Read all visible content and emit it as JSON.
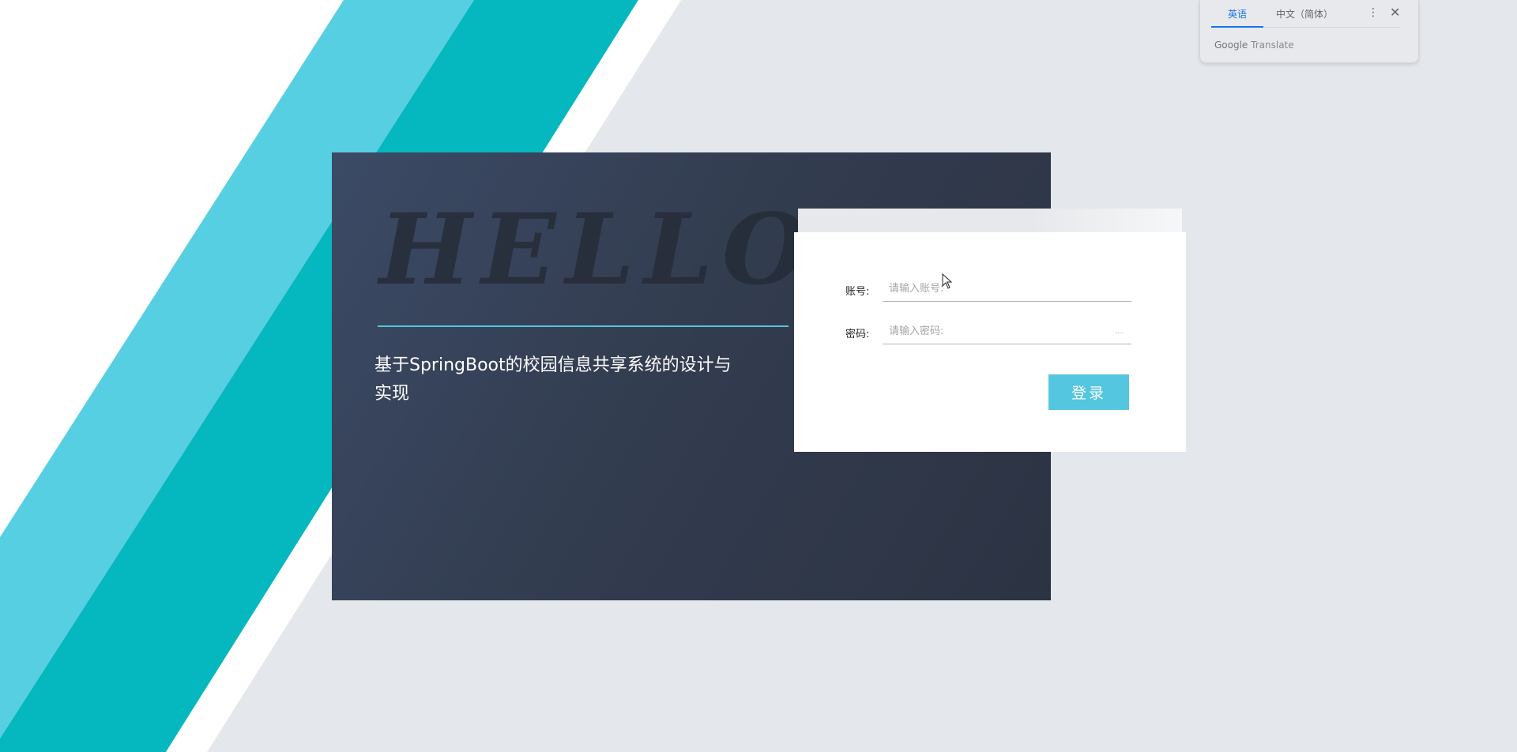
{
  "colors": {
    "page_bg": "#e4e8ec",
    "stripe_light": "#56cfe3",
    "stripe_teal": "#05b7be",
    "card_dark": "#333d50",
    "accent": "#54c6e0"
  },
  "card": {
    "watermark": "HELLO",
    "title": "基于SpringBoot的校园信息共享系统的设计与实现"
  },
  "login": {
    "username_label": "账号:",
    "username_placeholder": "请输入账号:",
    "password_label": "密码:",
    "password_placeholder": "请输入密码:",
    "submit_label": "登录"
  },
  "translate_popup": {
    "tab_source": "英语",
    "tab_target": "中文（简体）",
    "more_icon": "more-vertical-icon",
    "more_glyph": "⋮",
    "close_icon": "close-icon",
    "close_glyph": "✕",
    "brand_google": "Google",
    "brand_translate": "Translate"
  }
}
